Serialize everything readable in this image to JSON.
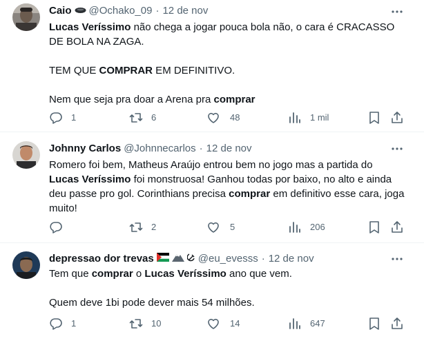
{
  "tweets": [
    {
      "name": "Caio",
      "handle": "@Ochako_09",
      "dot": "·",
      "date": "12 de nov",
      "paragraphs": [
        [
          {
            "t": "Lucas Veríssimo",
            "b": true
          },
          {
            "t": " não chega a jogar pouca bola não, o cara é CRACASSO DE BOLA NA ZAGA.",
            "b": false
          }
        ],
        [
          {
            "t": "TEM QUE ",
            "b": false
          },
          {
            "t": "COMPRAR",
            "b": true
          },
          {
            "t": " EM DEFINITIVO.",
            "b": false
          }
        ],
        [
          {
            "t": "Nem que seja pra doar a Arena pra ",
            "b": false
          },
          {
            "t": "comprar",
            "b": true
          }
        ]
      ],
      "replies": "1",
      "reposts": "6",
      "likes": "48",
      "views": "1 mil"
    },
    {
      "name": "Johnny Carlos",
      "handle": "@Johnnecarlos",
      "dot": "·",
      "date": "12 de nov",
      "paragraphs": [
        [
          {
            "t": "Romero foi bem, Matheus Araújo entrou bem no jogo mas a partida do ",
            "b": false
          },
          {
            "t": "Lucas Veríssimo",
            "b": true
          },
          {
            "t": " foi monstruosa! Ganhou todas por baixo, no alto e ainda deu passe pro gol. Corinthians precisa ",
            "b": false
          },
          {
            "t": "comprar",
            "b": true
          },
          {
            "t": " em definitivo esse cara, joga muito!",
            "b": false
          }
        ]
      ],
      "replies": "",
      "reposts": "2",
      "likes": "5",
      "views": "206"
    },
    {
      "name": "depressao dor trevas",
      "handle": "@eu_evesss",
      "dot": "·",
      "date": "12 de nov",
      "paragraphs": [
        [
          {
            "t": "Tem que ",
            "b": false
          },
          {
            "t": "comprar",
            "b": true
          },
          {
            "t": " o ",
            "b": false
          },
          {
            "t": "Lucas Veríssimo",
            "b": true
          },
          {
            "t": " ano que vem.",
            "b": false
          }
        ],
        [
          {
            "t": "Quem deve 1bi pode dever mais 54 milhões.",
            "b": false
          }
        ]
      ],
      "replies": "1",
      "reposts": "10",
      "likes": "14",
      "views": "647"
    }
  ]
}
